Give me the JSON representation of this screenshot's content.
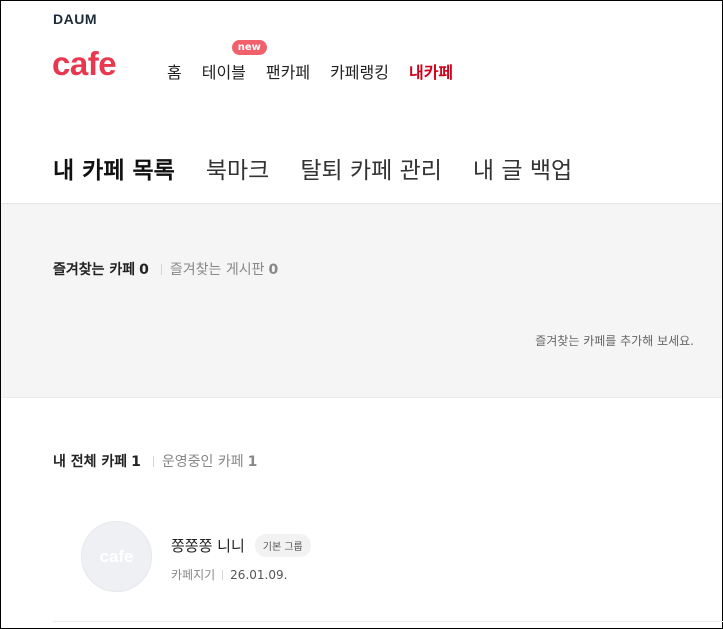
{
  "brand": {
    "daum": "DAUM",
    "cafe": "cafe"
  },
  "gnb": {
    "items": [
      {
        "label": "홈"
      },
      {
        "label": "테이블",
        "badge": "new"
      },
      {
        "label": "팬카페"
      },
      {
        "label": "카페랭킹"
      },
      {
        "label": "내카페",
        "active": true
      }
    ]
  },
  "tabs": [
    {
      "label": "내 카페 목록",
      "active": true
    },
    {
      "label": "북마크"
    },
    {
      "label": "탈퇴 카페 관리"
    },
    {
      "label": "내 글 백업"
    }
  ],
  "favorites": {
    "tabs": [
      {
        "label": "즐겨찾는 카페",
        "count": "0",
        "active": true
      },
      {
        "label": "즐겨찾는 게시판",
        "count": "0"
      }
    ],
    "empty_message": "즐겨찾는 카페를 추가해 보세요."
  },
  "my_cafes": {
    "tabs": [
      {
        "label": "내 전체 카페",
        "count": "1",
        "active": true
      },
      {
        "label": "운영중인 카페",
        "count": "1"
      }
    ],
    "items": [
      {
        "thumb_text": "cafe",
        "name": "쫑쫑쫑 니니",
        "group": "기본 그룹",
        "meta_label": "카페지기",
        "date": "26.01.09."
      }
    ]
  },
  "colors": {
    "brand": "#e8384f",
    "active_nav": "#d0021b",
    "badge": "#f0616b"
  }
}
